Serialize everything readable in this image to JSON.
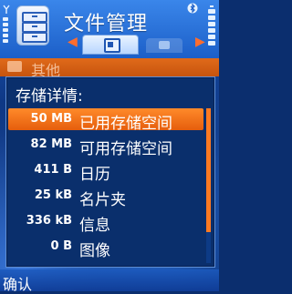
{
  "header": {
    "title": "文件管理",
    "bluetooth_icon": "bluetooth-icon",
    "app_icon": "file-manager-icon",
    "signal_icon": "signal-strength-icon",
    "battery_icon": "battery-icon"
  },
  "tabs": [
    {
      "icon": "phone-memory-icon",
      "active": true
    },
    {
      "icon": "memory-card-icon",
      "active": false
    }
  ],
  "background_row": {
    "label": "其他"
  },
  "popup": {
    "title": "存储详情:",
    "items": [
      {
        "size": "50 MB",
        "label": "已用存储空间"
      },
      {
        "size": "82 MB",
        "label": "可用存储空间"
      },
      {
        "size": "411 B",
        "label": "日历"
      },
      {
        "size": "25 kB",
        "label": "名片夹"
      },
      {
        "size": "336 kB",
        "label": "信息"
      },
      {
        "size": "0 B",
        "label": "图像"
      }
    ],
    "selected_index": 0,
    "scroll_fraction": 0.8
  },
  "softkeys": {
    "left": "确认"
  },
  "colors": {
    "accent": "#e55e0d",
    "panel": "#0a2f6c",
    "header": "#1c5fc8"
  }
}
